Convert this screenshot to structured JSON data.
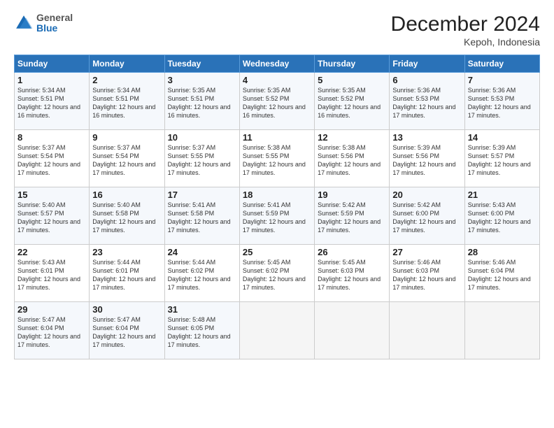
{
  "logo": {
    "general": "General",
    "blue": "Blue"
  },
  "header": {
    "month_year": "December 2024",
    "location": "Kepoh, Indonesia"
  },
  "days_of_week": [
    "Sunday",
    "Monday",
    "Tuesday",
    "Wednesday",
    "Thursday",
    "Friday",
    "Saturday"
  ],
  "weeks": [
    [
      {
        "day": "1",
        "sunrise": "5:34 AM",
        "sunset": "5:51 PM",
        "daylight": "12 hours and 16 minutes."
      },
      {
        "day": "2",
        "sunrise": "5:34 AM",
        "sunset": "5:51 PM",
        "daylight": "12 hours and 16 minutes."
      },
      {
        "day": "3",
        "sunrise": "5:35 AM",
        "sunset": "5:51 PM",
        "daylight": "12 hours and 16 minutes."
      },
      {
        "day": "4",
        "sunrise": "5:35 AM",
        "sunset": "5:52 PM",
        "daylight": "12 hours and 16 minutes."
      },
      {
        "day": "5",
        "sunrise": "5:35 AM",
        "sunset": "5:52 PM",
        "daylight": "12 hours and 16 minutes."
      },
      {
        "day": "6",
        "sunrise": "5:36 AM",
        "sunset": "5:53 PM",
        "daylight": "12 hours and 17 minutes."
      },
      {
        "day": "7",
        "sunrise": "5:36 AM",
        "sunset": "5:53 PM",
        "daylight": "12 hours and 17 minutes."
      }
    ],
    [
      {
        "day": "8",
        "sunrise": "5:37 AM",
        "sunset": "5:54 PM",
        "daylight": "12 hours and 17 minutes."
      },
      {
        "day": "9",
        "sunrise": "5:37 AM",
        "sunset": "5:54 PM",
        "daylight": "12 hours and 17 minutes."
      },
      {
        "day": "10",
        "sunrise": "5:37 AM",
        "sunset": "5:55 PM",
        "daylight": "12 hours and 17 minutes."
      },
      {
        "day": "11",
        "sunrise": "5:38 AM",
        "sunset": "5:55 PM",
        "daylight": "12 hours and 17 minutes."
      },
      {
        "day": "12",
        "sunrise": "5:38 AM",
        "sunset": "5:56 PM",
        "daylight": "12 hours and 17 minutes."
      },
      {
        "day": "13",
        "sunrise": "5:39 AM",
        "sunset": "5:56 PM",
        "daylight": "12 hours and 17 minutes."
      },
      {
        "day": "14",
        "sunrise": "5:39 AM",
        "sunset": "5:57 PM",
        "daylight": "12 hours and 17 minutes."
      }
    ],
    [
      {
        "day": "15",
        "sunrise": "5:40 AM",
        "sunset": "5:57 PM",
        "daylight": "12 hours and 17 minutes."
      },
      {
        "day": "16",
        "sunrise": "5:40 AM",
        "sunset": "5:58 PM",
        "daylight": "12 hours and 17 minutes."
      },
      {
        "day": "17",
        "sunrise": "5:41 AM",
        "sunset": "5:58 PM",
        "daylight": "12 hours and 17 minutes."
      },
      {
        "day": "18",
        "sunrise": "5:41 AM",
        "sunset": "5:59 PM",
        "daylight": "12 hours and 17 minutes."
      },
      {
        "day": "19",
        "sunrise": "5:42 AM",
        "sunset": "5:59 PM",
        "daylight": "12 hours and 17 minutes."
      },
      {
        "day": "20",
        "sunrise": "5:42 AM",
        "sunset": "6:00 PM",
        "daylight": "12 hours and 17 minutes."
      },
      {
        "day": "21",
        "sunrise": "5:43 AM",
        "sunset": "6:00 PM",
        "daylight": "12 hours and 17 minutes."
      }
    ],
    [
      {
        "day": "22",
        "sunrise": "5:43 AM",
        "sunset": "6:01 PM",
        "daylight": "12 hours and 17 minutes."
      },
      {
        "day": "23",
        "sunrise": "5:44 AM",
        "sunset": "6:01 PM",
        "daylight": "12 hours and 17 minutes."
      },
      {
        "day": "24",
        "sunrise": "5:44 AM",
        "sunset": "6:02 PM",
        "daylight": "12 hours and 17 minutes."
      },
      {
        "day": "25",
        "sunrise": "5:45 AM",
        "sunset": "6:02 PM",
        "daylight": "12 hours and 17 minutes."
      },
      {
        "day": "26",
        "sunrise": "5:45 AM",
        "sunset": "6:03 PM",
        "daylight": "12 hours and 17 minutes."
      },
      {
        "day": "27",
        "sunrise": "5:46 AM",
        "sunset": "6:03 PM",
        "daylight": "12 hours and 17 minutes."
      },
      {
        "day": "28",
        "sunrise": "5:46 AM",
        "sunset": "6:04 PM",
        "daylight": "12 hours and 17 minutes."
      }
    ],
    [
      {
        "day": "29",
        "sunrise": "5:47 AM",
        "sunset": "6:04 PM",
        "daylight": "12 hours and 17 minutes."
      },
      {
        "day": "30",
        "sunrise": "5:47 AM",
        "sunset": "6:04 PM",
        "daylight": "12 hours and 17 minutes."
      },
      {
        "day": "31",
        "sunrise": "5:48 AM",
        "sunset": "6:05 PM",
        "daylight": "12 hours and 17 minutes."
      },
      null,
      null,
      null,
      null
    ]
  ]
}
